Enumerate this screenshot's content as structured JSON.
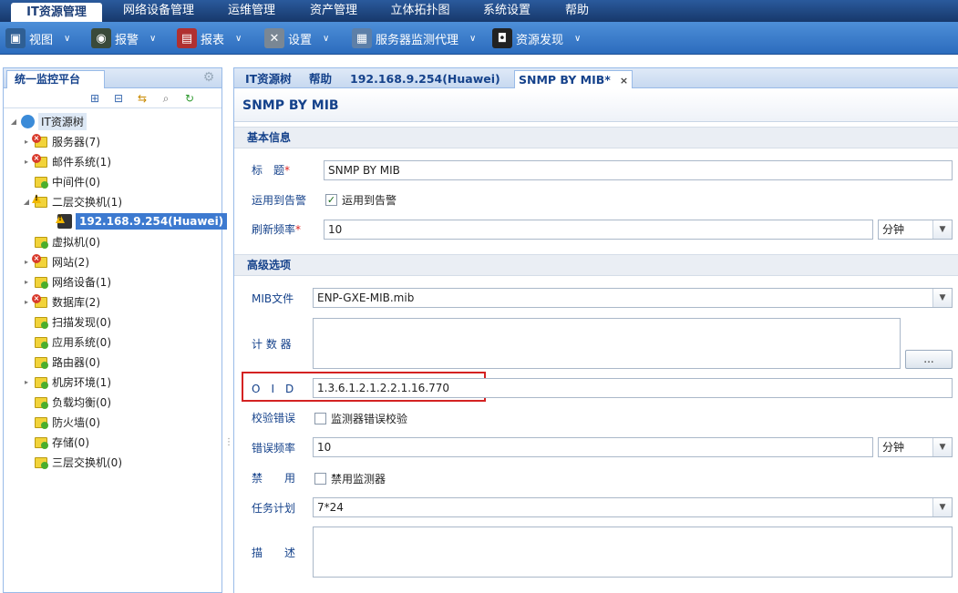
{
  "top_menu": [
    {
      "label": "IT资源管理",
      "active": true
    },
    {
      "label": "网络设备管理"
    },
    {
      "label": "运维管理"
    },
    {
      "label": "资产管理"
    },
    {
      "label": "立体拓扑图"
    },
    {
      "label": "系统设置"
    },
    {
      "label": "帮助"
    }
  ],
  "toolbar": [
    {
      "label": "视图",
      "icon": "monitor-icon"
    },
    {
      "label": "报警",
      "icon": "alarm-icon"
    },
    {
      "label": "报表",
      "icon": "report-icon"
    },
    {
      "label": "设置",
      "icon": "tools-icon"
    },
    {
      "label": "服务器监测代理",
      "icon": "agent-icon"
    },
    {
      "label": "资源发现",
      "icon": "discovery-icon"
    }
  ],
  "left_panel": {
    "tab_label": "统一监控平台",
    "tree_root": "IT资源树",
    "tree": [
      {
        "label": "服务器(7)",
        "status": "error",
        "expandable": true
      },
      {
        "label": "邮件系统(1)",
        "status": "error",
        "expandable": true
      },
      {
        "label": "中间件(0)",
        "status": "ok",
        "expandable": false
      },
      {
        "label": "二层交换机(1)",
        "status": "warning",
        "expandable": true,
        "expanded": true
      },
      {
        "label": "192.168.9.254(Huawei)",
        "status": "warning",
        "child": true,
        "selected": true
      },
      {
        "label": "虚拟机(0)",
        "status": "ok",
        "expandable": false
      },
      {
        "label": "网站(2)",
        "status": "error",
        "expandable": true
      },
      {
        "label": "网络设备(1)",
        "status": "ok",
        "expandable": true
      },
      {
        "label": "数据库(2)",
        "status": "error",
        "expandable": true
      },
      {
        "label": "扫描发现(0)",
        "status": "ok",
        "expandable": false
      },
      {
        "label": "应用系统(0)",
        "status": "ok",
        "expandable": false
      },
      {
        "label": "路由器(0)",
        "status": "ok",
        "expandable": false
      },
      {
        "label": "机房环境(1)",
        "status": "ok",
        "expandable": true
      },
      {
        "label": "负载均衡(0)",
        "status": "ok",
        "expandable": false
      },
      {
        "label": "防火墙(0)",
        "status": "ok",
        "expandable": false
      },
      {
        "label": "存储(0)",
        "status": "ok",
        "expandable": false
      },
      {
        "label": "三层交换机(0)",
        "status": "ok",
        "expandable": false
      }
    ]
  },
  "right_panel": {
    "tabs": [
      {
        "label": "IT资源树"
      },
      {
        "label": "帮助"
      },
      {
        "label": "192.168.9.254(Huawei)"
      },
      {
        "label": "SNMP BY MIB*",
        "active": true,
        "closable": true
      }
    ],
    "title": "SNMP BY MIB",
    "section_basic": "基本信息",
    "title_label": "标　题",
    "title_value": "SNMP BY MIB",
    "apply_alarm_label": "运用到告警",
    "apply_alarm_checkbox": "运用到告警",
    "refresh_label": "刷新频率",
    "refresh_value": "10",
    "refresh_unit": "分钟",
    "section_advanced": "高级选项",
    "mib_label": "MIB文件",
    "mib_value": "ENP-GXE-MIB.mib",
    "counter_label": "计 数 器",
    "counter_button": "...",
    "oid_label": "O　I　D",
    "oid_value": "1.3.6.1.2.1.2.2.1.16.770",
    "verify_label": "校验错误",
    "verify_checkbox": "监测器错误校验",
    "error_freq_label": "错误频率",
    "error_freq_value": "10",
    "error_freq_unit": "分钟",
    "disable_label": "禁　　用",
    "disable_checkbox": "禁用监测器",
    "schedule_label": "任务计划",
    "schedule_value": "7*24",
    "desc_label": "描　　述",
    "required_mark": "*",
    "check_mark": "✓"
  },
  "colors": {
    "accent": "#15428b",
    "highlight": "#d42222",
    "selected": "#3d7ad0"
  }
}
